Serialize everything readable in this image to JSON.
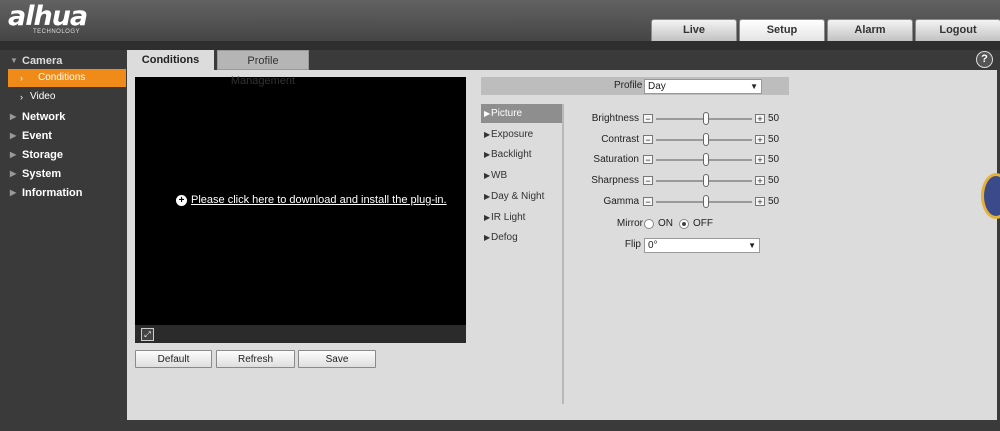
{
  "header": {
    "logo_text": "alhua",
    "logo_sub": "TECHNOLOGY",
    "tabs": [
      {
        "label": "Live"
      },
      {
        "label": "Setup"
      },
      {
        "label": "Alarm"
      },
      {
        "label": "Logout"
      }
    ],
    "active_tab": "Setup"
  },
  "sidebar": {
    "items": [
      {
        "label": "Camera"
      },
      {
        "label": "Conditions"
      },
      {
        "label": "Video"
      },
      {
        "label": "Network"
      },
      {
        "label": "Event"
      },
      {
        "label": "Storage"
      },
      {
        "label": "System"
      },
      {
        "label": "Information"
      }
    ],
    "active_item": "Conditions"
  },
  "content": {
    "tabs": [
      {
        "label": "Conditions"
      },
      {
        "label": "Profile Management"
      }
    ],
    "help_icon": "?",
    "video": {
      "plugin_text": "Please click here to download and install the plug-in."
    },
    "buttons": {
      "default": "Default",
      "refresh": "Refresh",
      "save": "Save"
    },
    "profile": {
      "label": "Profile",
      "value": "Day"
    },
    "menu": [
      {
        "label": "Picture"
      },
      {
        "label": "Exposure"
      },
      {
        "label": "Backlight"
      },
      {
        "label": "WB"
      },
      {
        "label": "Day & Night"
      },
      {
        "label": "IR Light"
      },
      {
        "label": "Defog"
      }
    ],
    "active_menu": "Picture",
    "sliders": [
      {
        "label": "Brightness",
        "value": "50",
        "level": 0.5
      },
      {
        "label": "Contrast",
        "value": "50",
        "level": 0.5
      },
      {
        "label": "Saturation",
        "value": "50",
        "level": 0.5
      },
      {
        "label": "Sharpness",
        "value": "50",
        "level": 0.5
      },
      {
        "label": "Gamma",
        "value": "50",
        "level": 0.5
      }
    ],
    "mirror": {
      "label": "Mirror",
      "on_label": "ON",
      "off_label": "OFF",
      "selected": "OFF"
    },
    "flip": {
      "label": "Flip",
      "value": "0°"
    }
  },
  "colors": {
    "accent": "#f08a18",
    "menu_active": "#8e8e8e"
  }
}
